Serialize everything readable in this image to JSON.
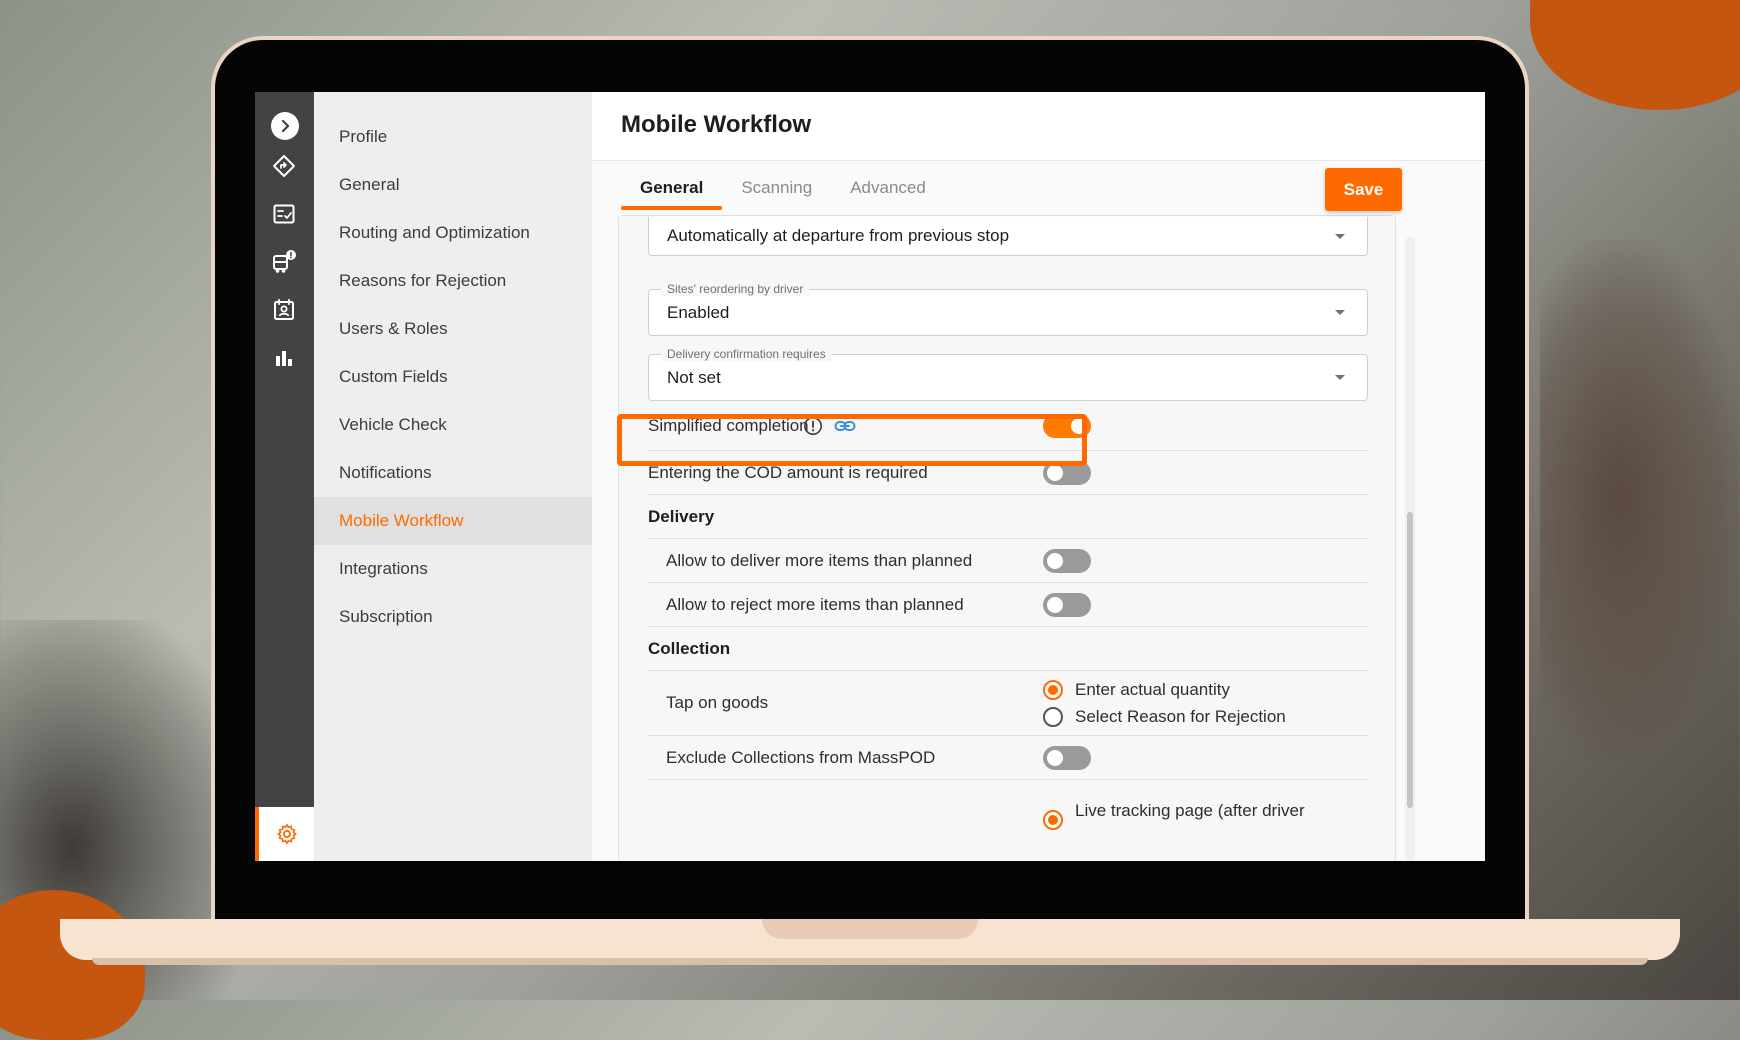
{
  "menu": {
    "items": [
      {
        "label": "Profile"
      },
      {
        "label": "General"
      },
      {
        "label": "Routing and Optimization"
      },
      {
        "label": "Reasons for Rejection"
      },
      {
        "label": "Users & Roles"
      },
      {
        "label": "Custom Fields"
      },
      {
        "label": "Vehicle Check"
      },
      {
        "label": "Notifications"
      },
      {
        "label": "Mobile Workflow",
        "active": true
      },
      {
        "label": "Integrations"
      },
      {
        "label": "Subscription"
      }
    ]
  },
  "rail": {
    "icons": [
      "chevron-right-icon",
      "route-icon",
      "checklist-icon",
      "truck-alert-icon",
      "contact-card-icon",
      "bar-chart-icon",
      "gear-icon"
    ]
  },
  "header": {
    "title": "Mobile Workflow"
  },
  "tabs": [
    {
      "label": "General",
      "active": true
    },
    {
      "label": "Scanning"
    },
    {
      "label": "Advanced"
    }
  ],
  "toolbar": {
    "save_label": "Save"
  },
  "accent_color": "#ff6a00",
  "fields": {
    "first_select": {
      "value": "Automatically at departure from previous stop"
    },
    "reordering": {
      "label": "Sites' reordering by driver",
      "value": "Enabled"
    },
    "confirmation": {
      "label": "Delivery confirmation requires",
      "value": "Not set"
    }
  },
  "toggles": {
    "simplified_completion": {
      "label": "Simplified completion",
      "on": true
    },
    "cod_required": {
      "label": "Entering the COD amount is required",
      "on": false
    },
    "deliver_more": {
      "label": "Allow to deliver more items than planned",
      "on": false
    },
    "reject_more": {
      "label": "Allow to reject more items than planned",
      "on": false
    },
    "exclude_masspod": {
      "label": "Exclude Collections from MassPOD",
      "on": false
    }
  },
  "sections": {
    "delivery": "Delivery",
    "collection": "Collection"
  },
  "tap_on_goods": {
    "label": "Tap on goods",
    "options": [
      {
        "label": "Enter actual quantity",
        "checked": true
      },
      {
        "label": "Select Reason for Rejection",
        "checked": false
      }
    ]
  },
  "live_tracking": {
    "label": "Live tracking page (after driver"
  }
}
